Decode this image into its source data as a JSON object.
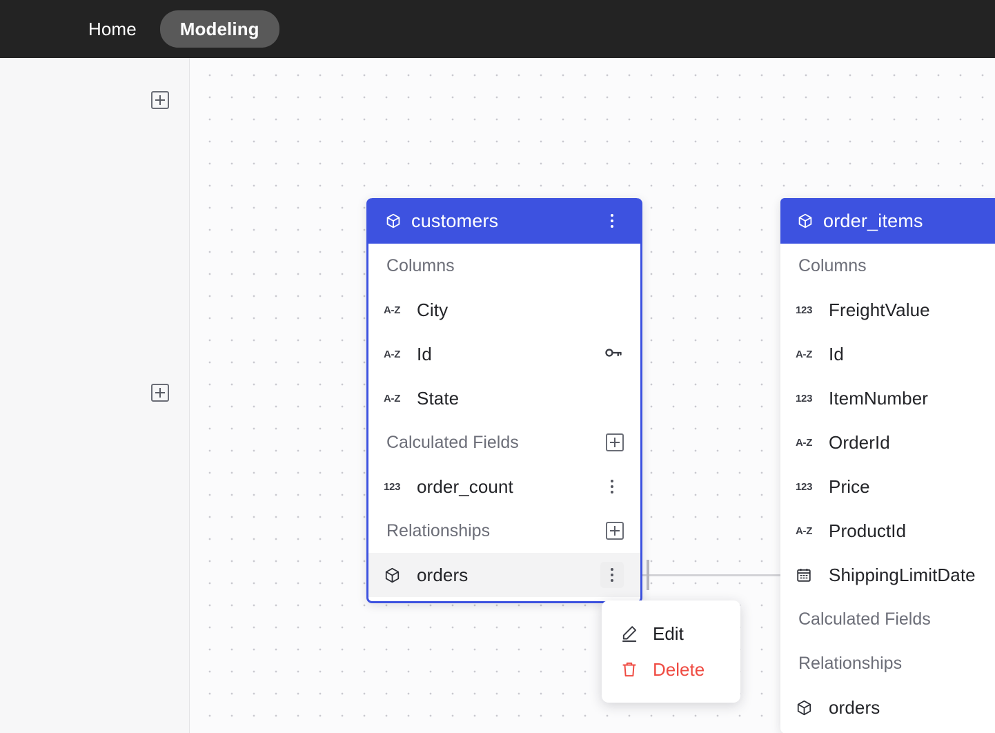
{
  "nav": {
    "items": [
      {
        "label": "Home",
        "active": false
      },
      {
        "label": "Modeling",
        "active": true
      }
    ]
  },
  "left_rail": {
    "add_buttons": [
      {
        "icon": "plus-box-icon"
      },
      {
        "icon": "plus-box-icon"
      }
    ]
  },
  "colors": {
    "header_blue": "#3d52e0",
    "nav_background": "#232323",
    "nav_active_pill": "#595959",
    "delete_red": "#ef4b42",
    "canvas_background": "#fbfbfc",
    "rail_background": "#f7f7f8",
    "row_highlight": "#f3f3f4"
  },
  "cards": {
    "customers": {
      "title": "customers",
      "icon": "cube-icon",
      "menu_icon": "more-vertical-icon",
      "selected": true,
      "sections": {
        "columns_label": "Columns",
        "calculated_label": "Calculated Fields",
        "relationships_label": "Relationships"
      },
      "columns": [
        {
          "name": "City",
          "type": "A-Z",
          "badge": ""
        },
        {
          "name": "Id",
          "type": "A-Z",
          "badge": "key-icon"
        },
        {
          "name": "State",
          "type": "A-Z",
          "badge": ""
        }
      ],
      "calculated_fields": [
        {
          "name": "order_count",
          "type": "123",
          "badge": "more-vertical-icon"
        }
      ],
      "relationships": [
        {
          "name": "orders",
          "type": "cube-icon",
          "badge": "more-vertical-icon",
          "highlighted": true
        }
      ]
    },
    "order_items": {
      "title": "order_items",
      "icon": "cube-icon",
      "selected": false,
      "sections": {
        "columns_label": "Columns",
        "calculated_label": "Calculated Fields",
        "relationships_label": "Relationships"
      },
      "columns": [
        {
          "name": "FreightValue",
          "type": "123"
        },
        {
          "name": "Id",
          "type": "A-Z"
        },
        {
          "name": "ItemNumber",
          "type": "123"
        },
        {
          "name": "OrderId",
          "type": "A-Z"
        },
        {
          "name": "Price",
          "type": "123"
        },
        {
          "name": "ProductId",
          "type": "A-Z"
        },
        {
          "name": "ShippingLimitDate",
          "type": "calendar-icon"
        }
      ],
      "calculated_fields": [],
      "relationships": [
        {
          "name": "orders",
          "type": "cube-icon"
        }
      ]
    }
  },
  "context_menu": {
    "items": [
      {
        "label": "Edit",
        "icon": "pencil-icon",
        "danger": false
      },
      {
        "label": "Delete",
        "icon": "trash-icon",
        "danger": true
      }
    ]
  }
}
